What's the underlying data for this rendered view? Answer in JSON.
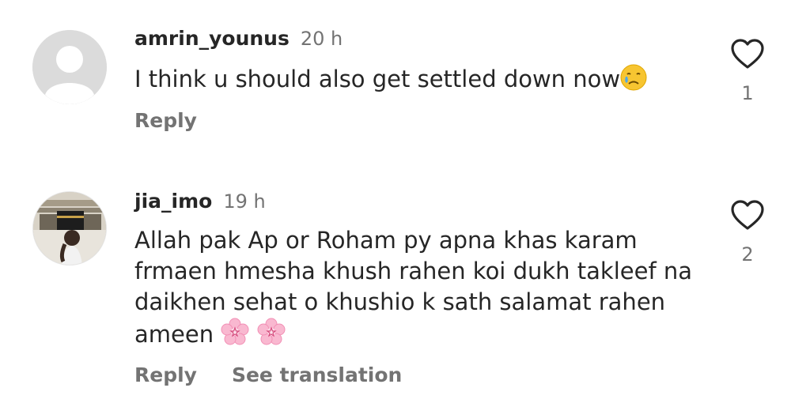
{
  "comments": [
    {
      "username": "amrin_younus",
      "time": "20 h",
      "text": "I think u should also get settled down now",
      "emoji": "crying-face",
      "reply_label": "Reply",
      "like_count": "1"
    },
    {
      "username": "jia_imo",
      "time": "19 h",
      "text_lines": [
        "Allah pak Ap or Roham py apna khas karam",
        "frmaen hmesha khush rahen koi dukh takleef na",
        "daikhen sehat o khushio k sath salamat rahen",
        "ameen"
      ],
      "emoji": "cherry-blossom",
      "reply_label": "Reply",
      "translate_label": "See translation",
      "like_count": "2"
    }
  ],
  "colors": {
    "text": "#262626",
    "secondary": "#737373",
    "avatar_placeholder": "#dbdbdb"
  }
}
